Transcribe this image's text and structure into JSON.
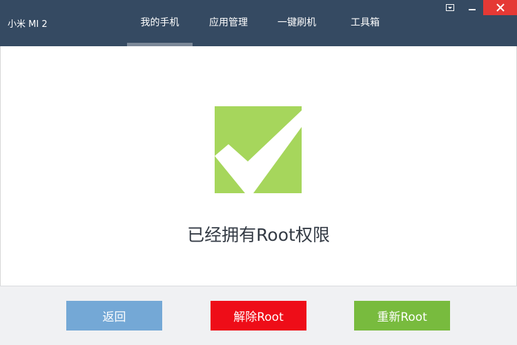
{
  "window": {
    "device_name": "小米 MI 2"
  },
  "nav": {
    "tabs": [
      {
        "label": "我的手机",
        "active": true
      },
      {
        "label": "应用管理",
        "active": false
      },
      {
        "label": "一键刷机",
        "active": false
      },
      {
        "label": "工具箱",
        "active": false
      }
    ]
  },
  "window_controls": {
    "menu_icon": "dropdown-menu-icon",
    "minimize_icon": "minimize-icon",
    "close_icon": "close-icon"
  },
  "main": {
    "status_icon": "check-icon",
    "status_text": "已经拥有Root权限"
  },
  "footer": {
    "back_label": "返回",
    "unroot_label": "解除Root",
    "reroot_label": "重新Root"
  },
  "colors": {
    "titlebar": "#354a62",
    "close": "#e53935",
    "check_green": "#a6d65c",
    "back_button": "#74a8d6",
    "unroot_button": "#ee0d18",
    "reroot_button": "#78bb3e"
  }
}
